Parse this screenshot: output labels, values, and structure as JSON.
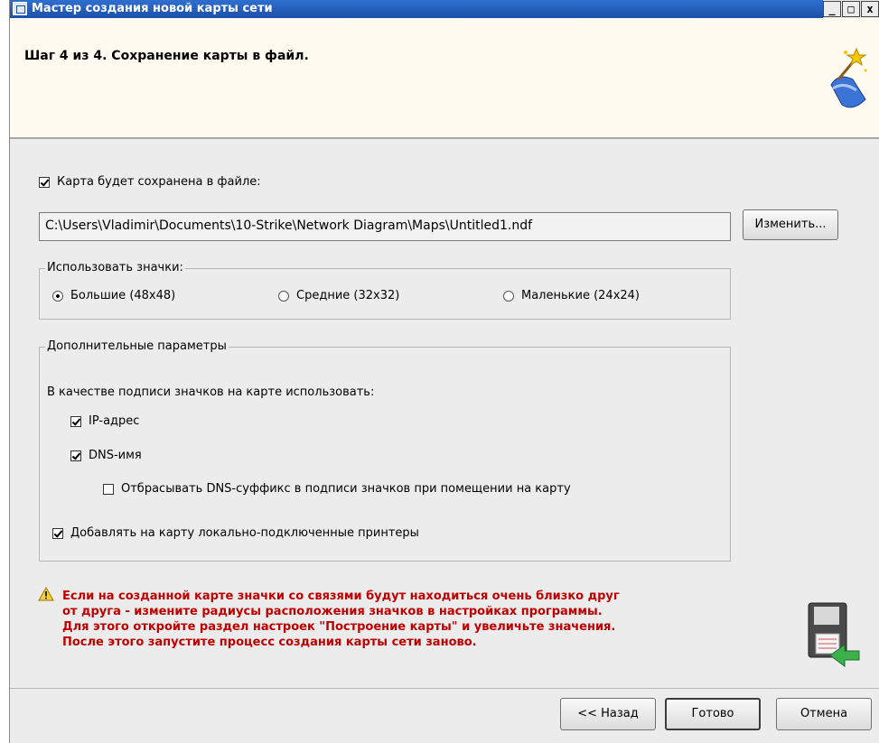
{
  "window": {
    "title": "Мастер создания новой карты сети",
    "controls": [
      "_",
      "□",
      "x"
    ]
  },
  "header": {
    "step_title": "Шаг 4 из 4. Сохранение карты в файл.",
    "icon": "wizard-icon"
  },
  "save_section": {
    "checkbox_label": "Карта будет сохранена в файле:",
    "checked": true,
    "path_value": "C:\\Users\\Vladimir\\Documents\\10-Strike\\Network Diagram\\Maps\\Untitled1.ndf",
    "change_button": "Изменить..."
  },
  "icons_group": {
    "legend": "Использовать значки:",
    "options": [
      {
        "label": "Большие (48x48)",
        "selected": true
      },
      {
        "label": "Средние (32x32)",
        "selected": false
      },
      {
        "label": "Маленькие (24x24)",
        "selected": false
      }
    ]
  },
  "extra_group": {
    "legend": "Дополнительные параметры",
    "caption_label": "В качестве подписи значков на карте использовать:",
    "ip_label": "IP-адрес",
    "ip_checked": true,
    "dns_label": "DNS-имя",
    "dns_checked": true,
    "strip_label": "Отбрасывать DNS-суффикс в подписи значков при помещении на карту",
    "strip_checked": false,
    "printers_label": "Добавлять на карту локально-подключенные принтеры",
    "printers_checked": true
  },
  "warning": {
    "line1": "Если на созданной карте значки со связями будут находиться очень близко друг",
    "line2": "от друга - измените радиусы расположения значков в настройках программы.",
    "line3": "Для этого откройте раздел настроек \"Построение карты\" и увеличьте значения.",
    "line4": "После этого запустите процесс создания карты сети заново.",
    "color": "#c00000",
    "icon": "warning-icon"
  },
  "footer": {
    "back": "<< Назад",
    "finish": "Готово",
    "cancel": "Отмена"
  }
}
